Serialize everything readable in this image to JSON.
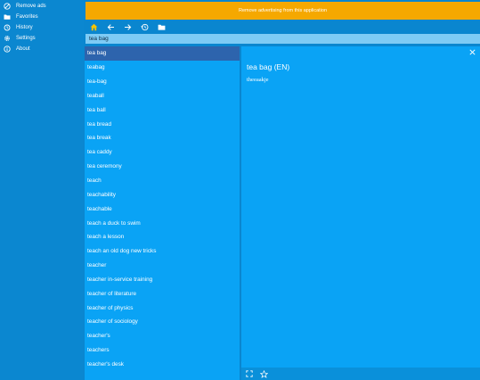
{
  "sidebar": {
    "items": [
      {
        "label": "Remove ads",
        "icon": "no-ads-icon"
      },
      {
        "label": "Favorites",
        "icon": "folder-icon"
      },
      {
        "label": "History",
        "icon": "history-icon"
      },
      {
        "label": "Settings",
        "icon": "gear-icon"
      },
      {
        "label": "About",
        "icon": "info-icon"
      }
    ]
  },
  "banner": {
    "text": "Remove advertising from this application"
  },
  "toolbar": {
    "icons": [
      "home-icon",
      "back-arrow-icon",
      "forward-arrow-icon",
      "history-icon",
      "folder-icon"
    ]
  },
  "search": {
    "value": "tea bag"
  },
  "word_list": [
    "tea bag",
    "teabag",
    "tea-bag",
    "teaball",
    "tea ball",
    "tea bread",
    "tea break",
    "tea caddy",
    "tea ceremony",
    "teach",
    "teachability",
    "teachable",
    "teach a duck to swim",
    "teach a lesson",
    "teach an old dog new tricks",
    "teacher",
    "teacher in-service training",
    "teacher of literature",
    "teacher of physics",
    "teacher of sociology",
    "teacher's",
    "teachers",
    "teacher's desk"
  ],
  "selected_index": 0,
  "entry": {
    "title": "tea bag (EN)",
    "body": "theeaakje"
  },
  "footer": {
    "icons": [
      "fullscreen-icon",
      "star-icon"
    ]
  },
  "colors": {
    "banner": "#f5a800",
    "sidebar": "#0b87d0",
    "list_bg": "#0aa3f5",
    "selected": "#2d64ad",
    "search_bg": "#7ecbf5",
    "toolbar_home": "#f5c400"
  }
}
